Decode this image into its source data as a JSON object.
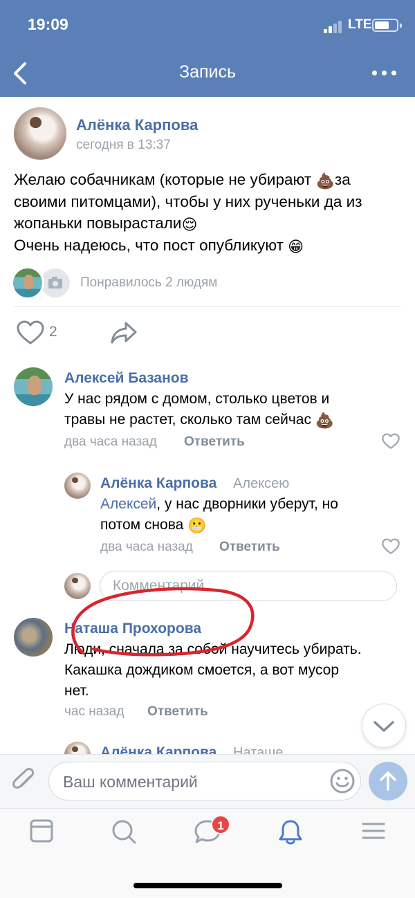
{
  "status_bar": {
    "time": "19:09",
    "network": "LTE"
  },
  "nav": {
    "title": "Запись"
  },
  "post": {
    "author": "Алёнка Карпова",
    "time": "сегодня в 13:37",
    "text_line1_a": "Желаю собачникам (которые не убирают ",
    "text_line1_emoji": "💩",
    "text_line1_b": "за",
    "text_line2": "своими питомцами), чтобы у них рученьки да из",
    "text_line3_a": "жопаньки повырастали",
    "text_line3_emoji": "😌",
    "text_line4_a": "Очень надеюсь, что пост опубликуют ",
    "text_line4_emoji": "😁",
    "likes_text": "Понравилось 2 людям",
    "like_count": "2"
  },
  "comments": [
    {
      "author": "Алексей Базанов",
      "text_line1": "У нас рядом с домом, столько цветов и",
      "text_line2": "травы не растет, сколько там сейчас ",
      "emoji": "💩",
      "time": "два часа назад",
      "reply": "Ответить"
    },
    {
      "author": "Алёнка Карпова",
      "to": "Алексею",
      "mention": "Алексей",
      "text_line1": ", у нас дворники уберут, но",
      "text_line2": "потом снова ",
      "emoji": "😬",
      "time": "два часа назад",
      "reply": "Ответить"
    },
    {
      "author": "Наташа Прохорова",
      "text_line1": "Люди, сначала за собой научитесь убирать.",
      "text_line2": "Какашка дождиком смоется, а вот мусор",
      "text_line3": "нет.",
      "time": "час назад",
      "reply": "Ответить"
    },
    {
      "author": "Алёнка Карпова",
      "to": "Наташе"
    }
  ],
  "reply_input": {
    "placeholder": "Комментарий"
  },
  "composer": {
    "placeholder": "Ваш комментарий"
  },
  "tabbar": {
    "messages_badge": "1"
  },
  "colors": {
    "header": "#5b80b8",
    "link": "#4a6ea6",
    "badge": "#e64646",
    "annotation": "#d8262c"
  }
}
